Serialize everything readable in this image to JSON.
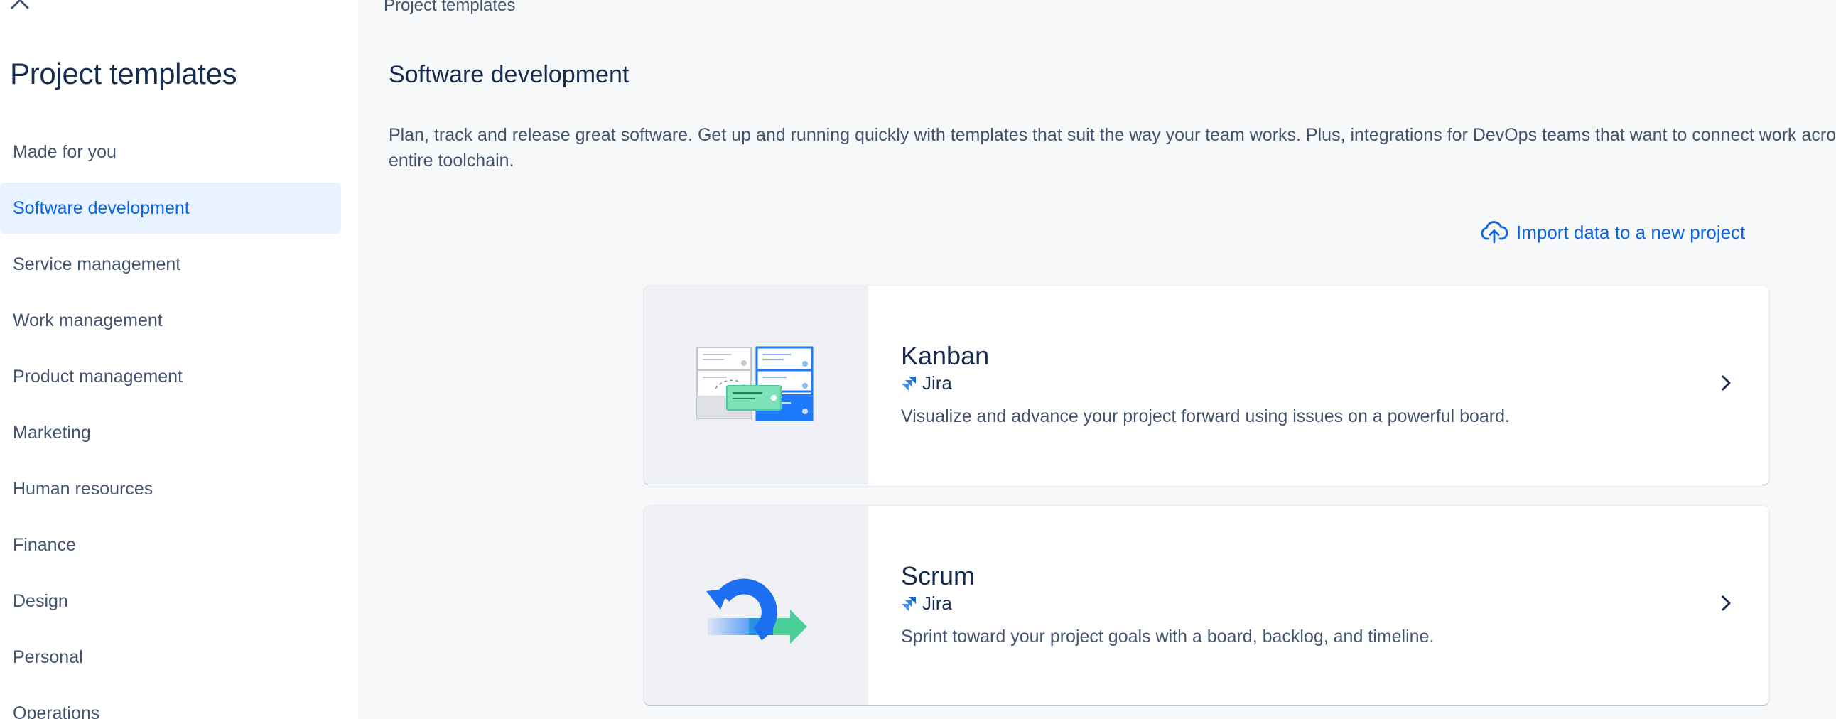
{
  "sidebar": {
    "close_icon": "close-icon",
    "title": "Project templates",
    "items": [
      {
        "label": "Made for you"
      },
      {
        "label": "Software development"
      },
      {
        "label": "Service management"
      },
      {
        "label": "Work management"
      },
      {
        "label": "Product management"
      },
      {
        "label": "Marketing"
      },
      {
        "label": "Human resources"
      },
      {
        "label": "Finance"
      },
      {
        "label": "Design"
      },
      {
        "label": "Personal"
      },
      {
        "label": "Operations"
      }
    ],
    "active_index": 1
  },
  "main": {
    "breadcrumb": "Project templates",
    "title": "Software development",
    "description": "Plan, track and release great software. Get up and running quickly with templates that suit the way your team works. Plus, integrations for DevOps teams that want to connect work across their entire toolchain.",
    "import_link": {
      "label": "Import data to a new project",
      "icon": "cloud-upload-icon"
    },
    "templates": [
      {
        "title": "Kanban",
        "product": "Jira",
        "description": "Visualize and advance your project forward using issues on a powerful board.",
        "illustration": "kanban-board-illustration"
      },
      {
        "title": "Scrum",
        "product": "Jira",
        "description": "Sprint toward your project goals with a board, backlog, and timeline.",
        "illustration": "scrum-cycle-illustration"
      }
    ]
  },
  "colors": {
    "accent": "#0c66e4",
    "active_bg": "#e9f2ff",
    "text": "#172b4d",
    "subtle_text": "#44546f",
    "page_bg": "#f7f8f9"
  }
}
